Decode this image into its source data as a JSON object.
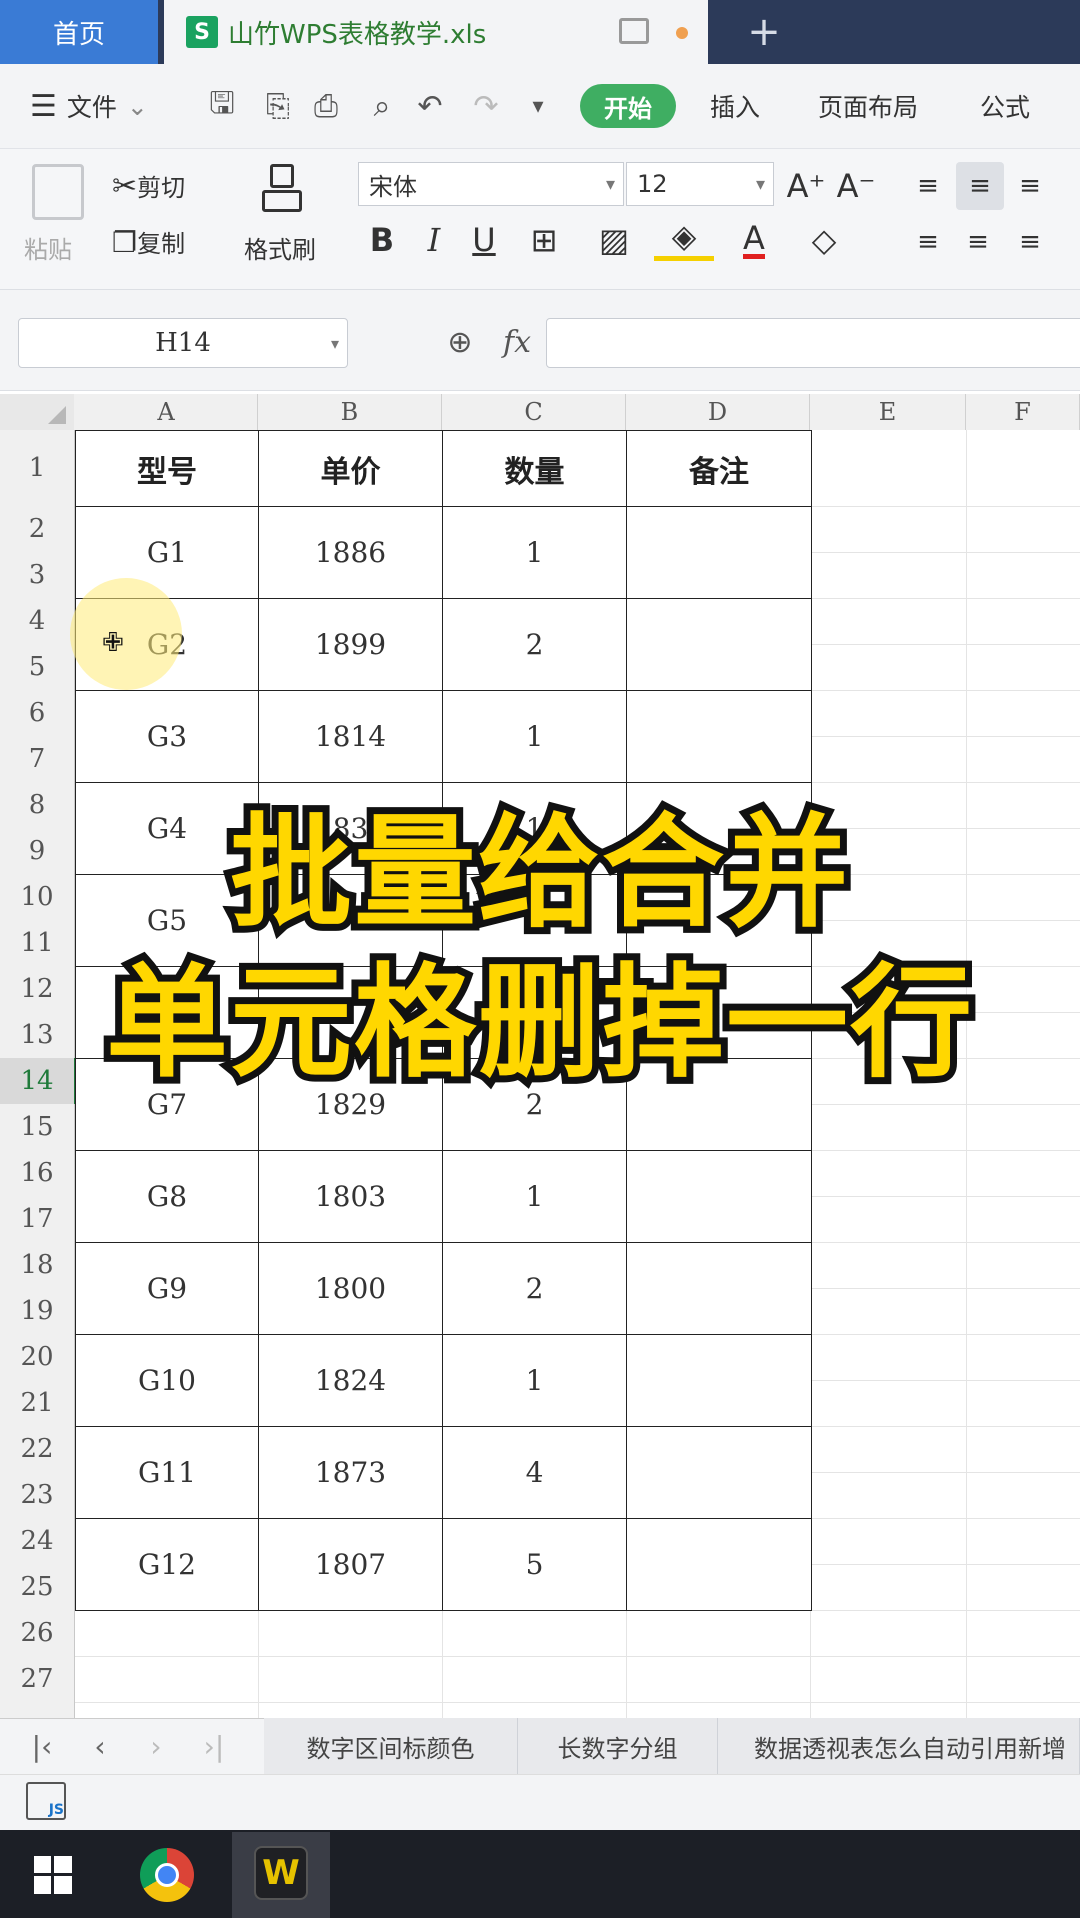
{
  "tabs": {
    "home": "首页",
    "file": "山竹WPS表格教学.xls",
    "file_icon": "S",
    "new_tab": "+"
  },
  "menu": {
    "file": "文件",
    "start": "开始",
    "insert": "插入",
    "layout": "页面布局",
    "formula": "公式"
  },
  "ribbon": {
    "paste": "粘贴",
    "cut": "剪切",
    "copy": "复制",
    "format_painter": "格式刷",
    "font_name": "宋体",
    "font_size": "12"
  },
  "formula_bar": {
    "name_box": "H14",
    "fx": "fx",
    "value": ""
  },
  "columns": [
    "A",
    "B",
    "C",
    "D",
    "E",
    "F"
  ],
  "rows": [
    "1",
    "2",
    "3",
    "4",
    "5",
    "6",
    "7",
    "8",
    "9",
    "10",
    "11",
    "12",
    "13",
    "14",
    "15",
    "16",
    "17",
    "18",
    "19",
    "20",
    "21",
    "22",
    "23",
    "24",
    "25",
    "26",
    "27"
  ],
  "table": {
    "headers": [
      "型号",
      "单价",
      "数量",
      "备注"
    ],
    "rows": [
      [
        "G1",
        "1886",
        "1",
        ""
      ],
      [
        "G2",
        "1899",
        "2",
        ""
      ],
      [
        "G3",
        "1814",
        "1",
        ""
      ],
      [
        "G4",
        "1833",
        "1",
        ""
      ],
      [
        "G5",
        "",
        "",
        ""
      ],
      [
        "",
        "",
        "",
        ""
      ],
      [
        "G7",
        "1829",
        "2",
        ""
      ],
      [
        "G8",
        "1803",
        "1",
        ""
      ],
      [
        "G9",
        "1800",
        "2",
        ""
      ],
      [
        "G10",
        "1824",
        "1",
        ""
      ],
      [
        "G11",
        "1873",
        "4",
        ""
      ],
      [
        "G12",
        "1807",
        "5",
        ""
      ]
    ]
  },
  "overlay": {
    "line1": "批量给合并",
    "line2": "单元格删掉一行"
  },
  "sheet_tabs": [
    "数字区间标颜色",
    "长数字分组",
    "数据透视表怎么自动引用新增"
  ],
  "status": {
    "macro": "JS"
  },
  "colors": {
    "accent_green": "#3fae62",
    "overlay_yellow": "#ffd700",
    "active_tab_blue": "#3a7bd5"
  }
}
